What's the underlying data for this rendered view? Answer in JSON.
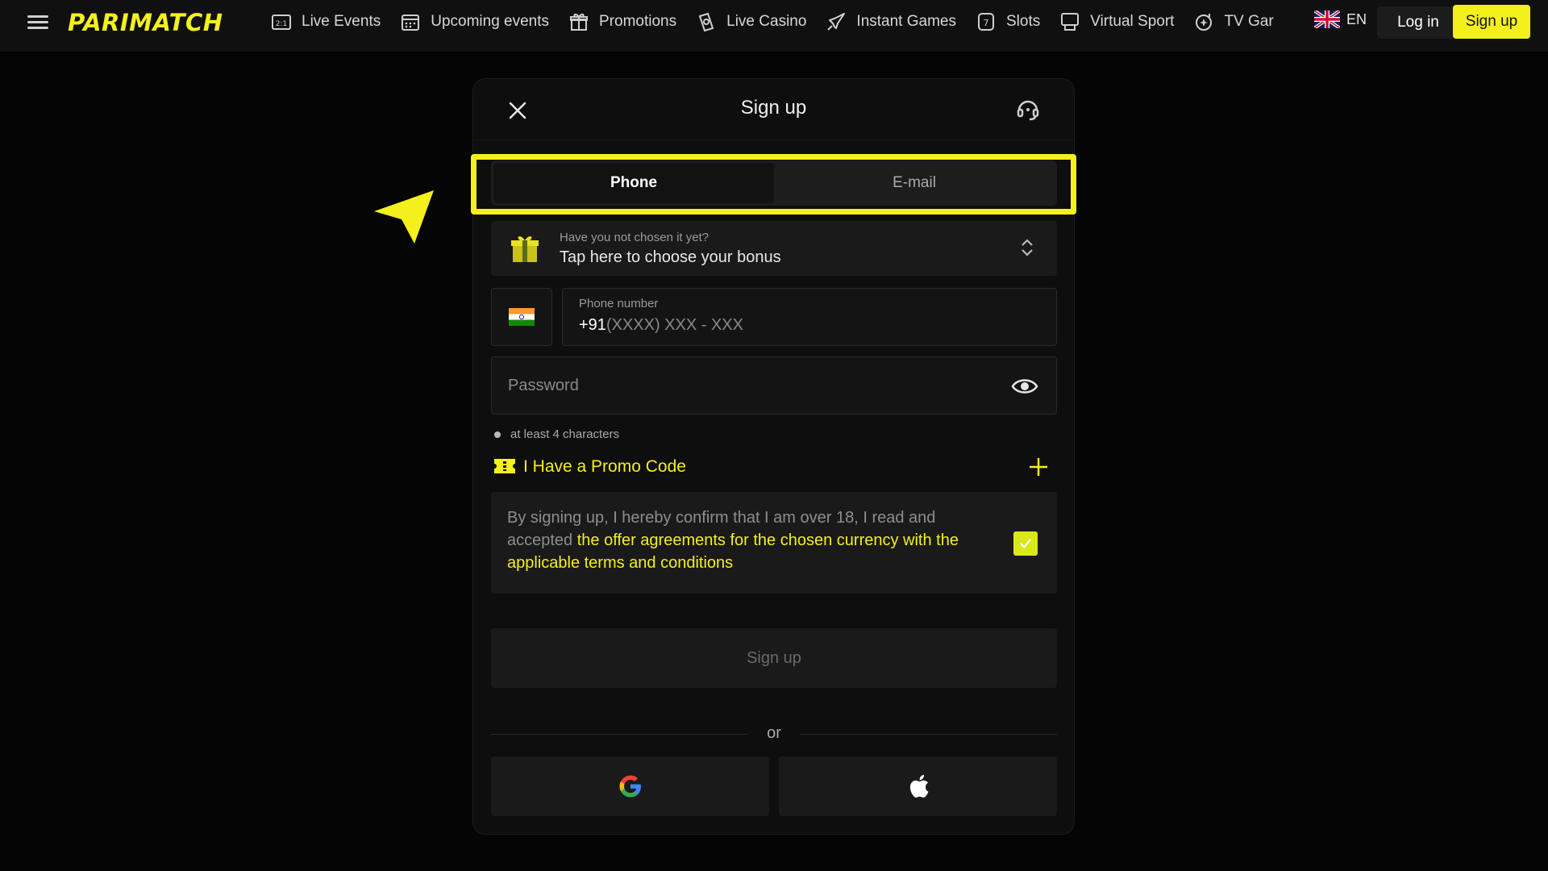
{
  "brand": {
    "logo_text": "PARIMATCH",
    "accent_color": "#f4f01c"
  },
  "nav": {
    "items": [
      {
        "label": "Live Events",
        "icon": "live-events-icon"
      },
      {
        "label": "Upcoming events",
        "icon": "calendar-icon"
      },
      {
        "label": "Promotions",
        "icon": "gift-icon"
      },
      {
        "label": "Live Casino",
        "icon": "casino-chip-icon"
      },
      {
        "label": "Instant Games",
        "icon": "rocket-icon"
      },
      {
        "label": "Slots",
        "icon": "slot-icon"
      },
      {
        "label": "Virtual Sport",
        "icon": "virtual-sport-icon"
      },
      {
        "label": "TV Gar",
        "icon": "tv-games-icon"
      }
    ],
    "live_events_badge": "2:1",
    "slots_badge": "7"
  },
  "header_actions": {
    "lang": "EN",
    "login_label": "Log in",
    "signup_label": "Sign up"
  },
  "modal": {
    "title": "Sign up",
    "tabs": [
      {
        "label": "Phone",
        "active": true
      },
      {
        "label": "E-mail",
        "active": false
      }
    ],
    "bonus": {
      "hint": "Have you not chosen it yet?",
      "label": "Tap here to choose your bonus"
    },
    "phone": {
      "label": "Phone number",
      "prefix": "+91",
      "mask": "(XXXX) XXX - XXX",
      "country": "India"
    },
    "password": {
      "placeholder": "Password"
    },
    "password_rule": "at least 4 characters",
    "promo_label": "I Have a Promo Code",
    "terms": {
      "text": "By signing up, I hereby confirm that I am over 18, I read and accepted ",
      "link": "the offer agreements for the chosen currency with the applicable terms and conditions",
      "checked": true
    },
    "signup_button": "Sign up",
    "divider_text": "or",
    "social": [
      "google-icon",
      "apple-icon"
    ]
  }
}
